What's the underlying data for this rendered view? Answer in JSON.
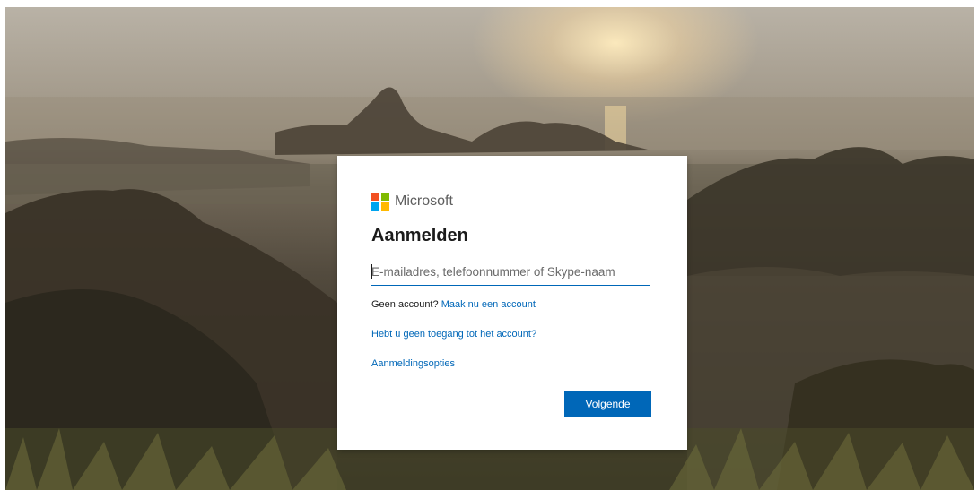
{
  "card": {
    "brand_name": "Microsoft",
    "logo_icon": "microsoft-logo-icon",
    "logo_colors": [
      "#f25022",
      "#7fba00",
      "#00a4ef",
      "#ffb900"
    ],
    "title": "Aanmelden",
    "email_input": {
      "value": "",
      "placeholder": "E-mailadres, telefoonnummer of Skype-naam"
    },
    "no_account_text": "Geen account?",
    "create_account_link": "Maak nu een account",
    "no_access_link": "Hebt u geen toegang tot het account?",
    "signin_options_link": "Aanmeldingsopties",
    "next_button": "Volgende"
  },
  "colors": {
    "accent": "#0067b8",
    "card_background": "#ffffff"
  },
  "background": {
    "image_subject": "rio-de-janeiro-sunset-landscape"
  }
}
